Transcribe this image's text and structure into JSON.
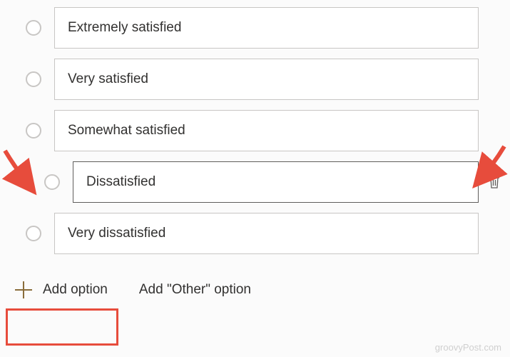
{
  "options": [
    {
      "label": "Extremely satisfied",
      "editing": false
    },
    {
      "label": "Very satisfied",
      "editing": false
    },
    {
      "label": "Somewhat satisfied",
      "editing": false
    },
    {
      "label": "Dissatisfied",
      "editing": true
    },
    {
      "label": "Very dissatisfied",
      "editing": false
    }
  ],
  "footer": {
    "add_option_label": "Add option",
    "add_other_label": "Add \"Other\" option"
  },
  "watermark": "groovyPost.com",
  "colors": {
    "annotation": "#e74c3c",
    "border": "#c8c6c4"
  }
}
